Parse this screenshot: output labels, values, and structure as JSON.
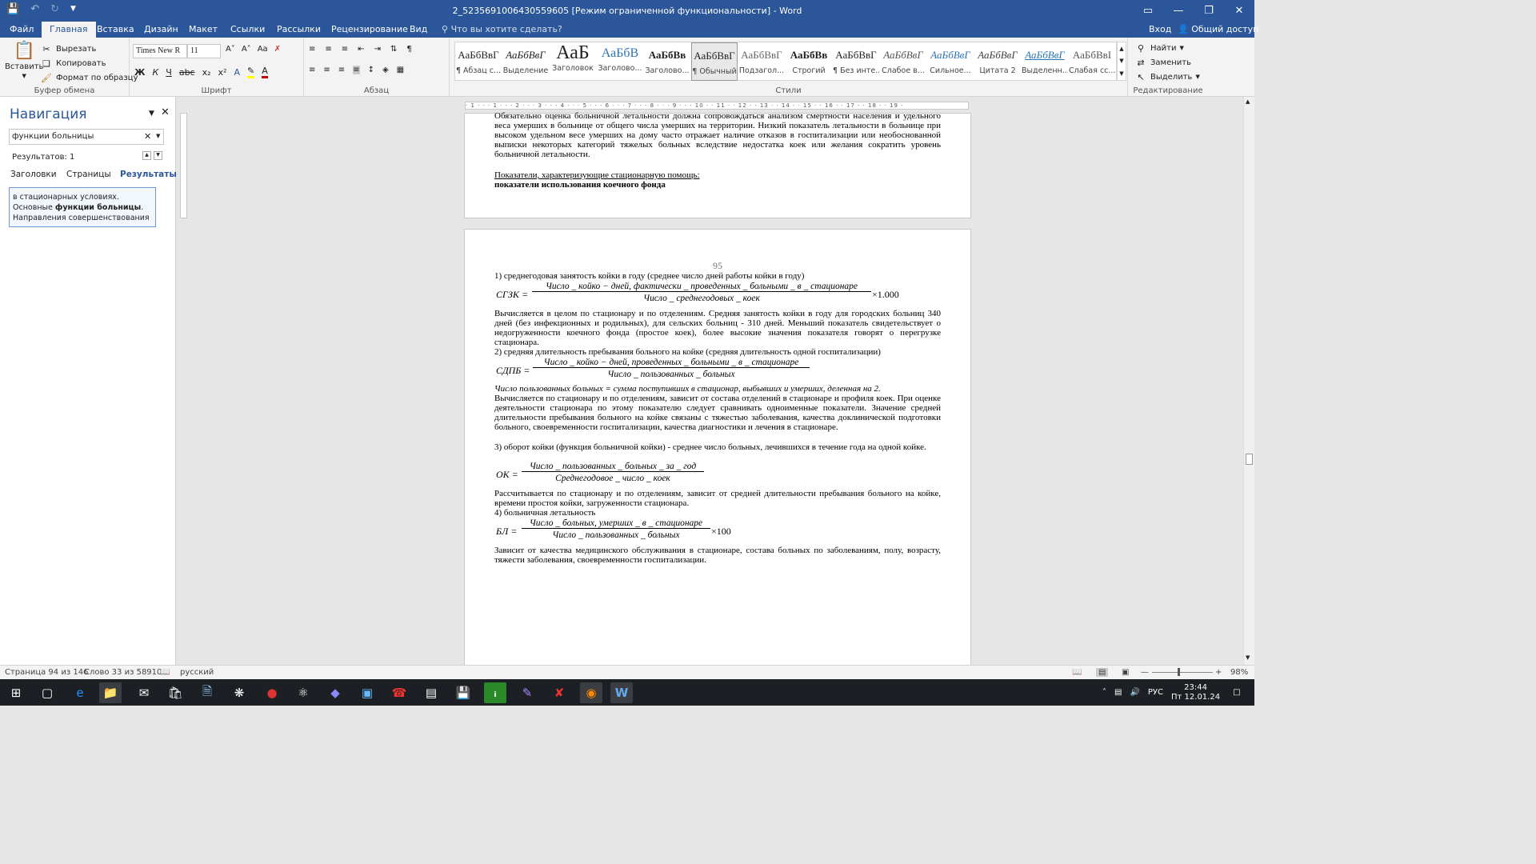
{
  "window": {
    "title": "2_5235691006430559605 [Режим ограниченной функциональности] - Word"
  },
  "tabs": [
    {
      "label": "Файл"
    },
    {
      "label": "Главная"
    },
    {
      "label": "Вставка"
    },
    {
      "label": "Дизайн"
    },
    {
      "label": "Макет"
    },
    {
      "label": "Ссылки"
    },
    {
      "label": "Рассылки"
    },
    {
      "label": "Рецензирование"
    },
    {
      "label": "Вид"
    }
  ],
  "tellme": "Что вы хотите сделать?",
  "signin": "Вход",
  "share": "Общий доступ",
  "clipboard": {
    "paste": "Вставить",
    "cut": "Вырезать",
    "copy": "Копировать",
    "format": "Формат по образцу",
    "label": "Буфер обмена"
  },
  "font": {
    "name": "Times New R",
    "size": "11",
    "label": "Шрифт",
    "bold": "Ж",
    "italic": "К",
    "underline": "Ч",
    "strike": "abc",
    "sub": "x₂",
    "sup": "x²",
    "case": "Аа"
  },
  "paragraph": {
    "label": "Абзац",
    "pilcrow": "¶"
  },
  "styles": {
    "label": "Стили",
    "items": [
      {
        "sample": "АаБбВвГ",
        "name": "¶ Абзац с..."
      },
      {
        "sample": "АаБбВвГ",
        "name": "Выделение"
      },
      {
        "sample": "АаБ",
        "name": "Заголовок"
      },
      {
        "sample": "АаБбВ",
        "name": "Заголово..."
      },
      {
        "sample": "АаБбВв",
        "name": "Заголово..."
      },
      {
        "sample": "АаБбВвГ",
        "name": "¶ Обычный"
      },
      {
        "sample": "АаБбВвГ",
        "name": "Подзагол..."
      },
      {
        "sample": "АаБбВв",
        "name": "Строгий"
      },
      {
        "sample": "АаБбВвГ",
        "name": "¶ Без инте..."
      },
      {
        "sample": "АаБбВвГ",
        "name": "Слабое в..."
      },
      {
        "sample": "АаБбВвГ",
        "name": "Сильное..."
      },
      {
        "sample": "АаБбВвГ",
        "name": "Цитата 2"
      },
      {
        "sample": "АаБбВвГ",
        "name": "Выделенн..."
      },
      {
        "sample": "АаБбВвI",
        "name": "Слабая сс..."
      }
    ]
  },
  "editing": {
    "find": "Найти",
    "replace": "Заменить",
    "select": "Выделить",
    "label": "Редактирование"
  },
  "nav": {
    "title": "Навигация",
    "search_value": "функции больницы",
    "results_count": "Результатов: 1",
    "tabs": [
      "Заголовки",
      "Страницы",
      "Результаты"
    ],
    "result": {
      "pre": "в стационарных условиях. Основные ",
      "bold": "функции больницы",
      "post": ". Направления совершенствования"
    }
  },
  "page1": {
    "para": "Обязательно оценка больничной летальности должна сопровождаться анализом смертности населения и удельного веса умерших в больнице от общего числа умерших на территории. Низкий показатель летальности в больнице при высоком удельном весе умерших на дому часто отражает наличие отказов в госпитализации или необоснованной выписки некоторых категорий тяжелых больных вследствие недостатка коек или желания сократить уровень больничной летальности.",
    "heading_u": "Показатели, характеризующие стационарную помощь:",
    "heading_b": "показатели использования коечного фонда"
  },
  "page2": {
    "page_number": "95",
    "item1": "1)  среднегодовая  занятость  койки  в  году  (среднее   число дней работы койки в году)",
    "f1": {
      "lhs": "СГЗК =",
      "num": "Число _ койко − дней, фактически _ проведенных _ больными _ в _ стационаре",
      "den": "Число _ среднегодовых _ коек",
      "tail": "×1.000"
    },
    "p1": "Вычисляется в целом по стационару и по отделениям. Средняя занятость койки в году для городских больниц 340 дней (без инфекционных и родильных), для сельских больниц - 310 дней. Меньший показатель свидетельствует о недогруженности коечного фонда (простое коек), более высокие значения показателя говорят о перегрузке стационара.",
    "item2": "2) средняя длительность пребывания больного на койке (средняя длительность одной госпитализации)",
    "f2": {
      "lhs": "СДПБ =",
      "num": "Число _ койко − дней, проведенных _ больными _ в _ стационаре",
      "den": "Число _ пользованных _ больных"
    },
    "note": "Число пользованных больных = сумма поступивших в стационар, выбывших и умерших, деленная на 2.",
    "p2": "Вычисляется по стационару и по отделениям, зависит от состава отделений в стационаре и профиля коек. При оценке деятельности стационара по этому показателю следует сравнивать одноименные показатели. Значение средней длительности пребывания больного на койке связаны с тяжестью заболевания, качества доклинической подготовки больного, своевременности госпитализации, качества диагностики и лечения в стационаре.",
    "item3": "3) оборот койки (функция больничной койки) - среднее число больных, лечившихся в течение года на одной койке.",
    "f3": {
      "lhs": "ОК =",
      "num": "Число _ пользованных _ больных _ за _ год",
      "den": "Среднегодовое _ число _ коек"
    },
    "p3": "Рассчитывается по стационару и по отделениям, зависит от средней длительности пребывания больного на койке, времени простоя койки, загруженности стационара.",
    "item4": "4) больничная летальность",
    "f4": {
      "lhs": "БЛ =",
      "num": "Число _ больных, умерших _ в _ стационаре",
      "den": "Число _ пользованных _ больных",
      "tail": "×100"
    },
    "p4": "Зависит от качества медицинского обслуживания в стационаре, состава больных по заболеваниям, полу, возрасту, тяжести заболевания, своевременности госпитализации."
  },
  "status": {
    "page": "Страница 94 из 146",
    "words": "Слово 33 из 58910",
    "lang": "русский",
    "zoom": "98%"
  },
  "tray": {
    "lang": "РУС",
    "time": "23:44",
    "date": "Пт 12.01.24"
  },
  "colors": {
    "accent": "#2b579a"
  }
}
